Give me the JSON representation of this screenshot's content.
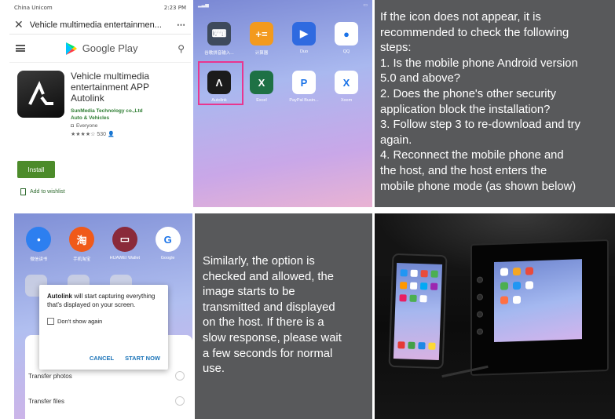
{
  "panel_play_store": {
    "status_left": "China Unicom",
    "status_right": "2:23 PM",
    "tab_title": "Vehicle multimedia entertainmen...",
    "menu_dots": "⋯",
    "brand": "Google Play",
    "app_name_lines": [
      "Vehicle multimedia",
      "entertainment APP",
      "Autolink"
    ],
    "developer": "SunMedia Technology co.,Ltd",
    "category": "Auto & Vehicles",
    "content_rating": "Everyone",
    "stars": "★★★★☆",
    "review_count": "530",
    "install_label": "Install",
    "wishlist_label": "Add to wishlist"
  },
  "panel_home_screen": {
    "row1": [
      {
        "label": "谷歌拼音输入...",
        "icon": "keyboard-icon",
        "color": "#3e4a5c",
        "glyph": "⌨"
      },
      {
        "label": "计算器",
        "icon": "calculator-icon",
        "color": "#f39a1e",
        "glyph": "+="
      },
      {
        "label": "Duo",
        "icon": "video-camera-icon",
        "color": "#2f6ae0",
        "glyph": "▶"
      },
      {
        "label": "QQ",
        "icon": "penguin-icon",
        "color": "#ffffff",
        "glyph": "●"
      }
    ],
    "row2": [
      {
        "label": "Autolink",
        "icon": "autolink-icon",
        "color": "#1b1b1b",
        "glyph": "Λ"
      },
      {
        "label": "Excel",
        "icon": "excel-icon",
        "color": "#1e7145",
        "glyph": "X"
      },
      {
        "label": "PayPal Busin...",
        "icon": "paypal-icon",
        "color": "#ffffff",
        "glyph": "P"
      },
      {
        "label": "Xoom",
        "icon": "xoom-icon",
        "color": "#ffffff",
        "glyph": "X"
      }
    ]
  },
  "panel_instructions": {
    "lines": [
      "If the icon does not appear, it is",
      "recommended to check the following",
      "steps:",
      "1. Is the mobile phone Android version",
      "5.0 and above?",
      "2. Does the phone's other security",
      "application block the installation?",
      "3. Follow step 3 to re-download and try",
      "again.",
      "4. Reconnect the mobile phone and",
      "the host, and the host enters the",
      "mobile phone mode (as shown below)"
    ]
  },
  "panel_permission": {
    "top_apps": [
      {
        "label": "微信读书",
        "icon": "wechat-read-icon",
        "color": "#2d7ff0",
        "glyph": "•"
      },
      {
        "label": "手机淘宝",
        "icon": "taobao-icon",
        "color": "#f05a1a",
        "glyph": "淘"
      },
      {
        "label": "HUAWEI Wallet",
        "icon": "wallet-icon",
        "color": "#8a2a3a",
        "glyph": "▭"
      },
      {
        "label": "Google",
        "icon": "google-icon",
        "color": "#ffffff",
        "glyph": "G"
      }
    ],
    "dialog_app": "Autolink",
    "dialog_text": " will start capturing everything that's displayed on your screen.",
    "checkbox_label": "Don't show again",
    "cancel_label": "CANCEL",
    "start_label": "START NOW",
    "sheet_items": [
      "Transfer photos",
      "Transfer files"
    ]
  },
  "panel_similarly": {
    "lines": [
      "Similarly, the option is",
      "checked and allowed, the",
      "image starts to be",
      "transmitted and displayed",
      "on the host. If there is a",
      "slow response, please wait",
      "a few seconds for normal",
      "use."
    ]
  }
}
